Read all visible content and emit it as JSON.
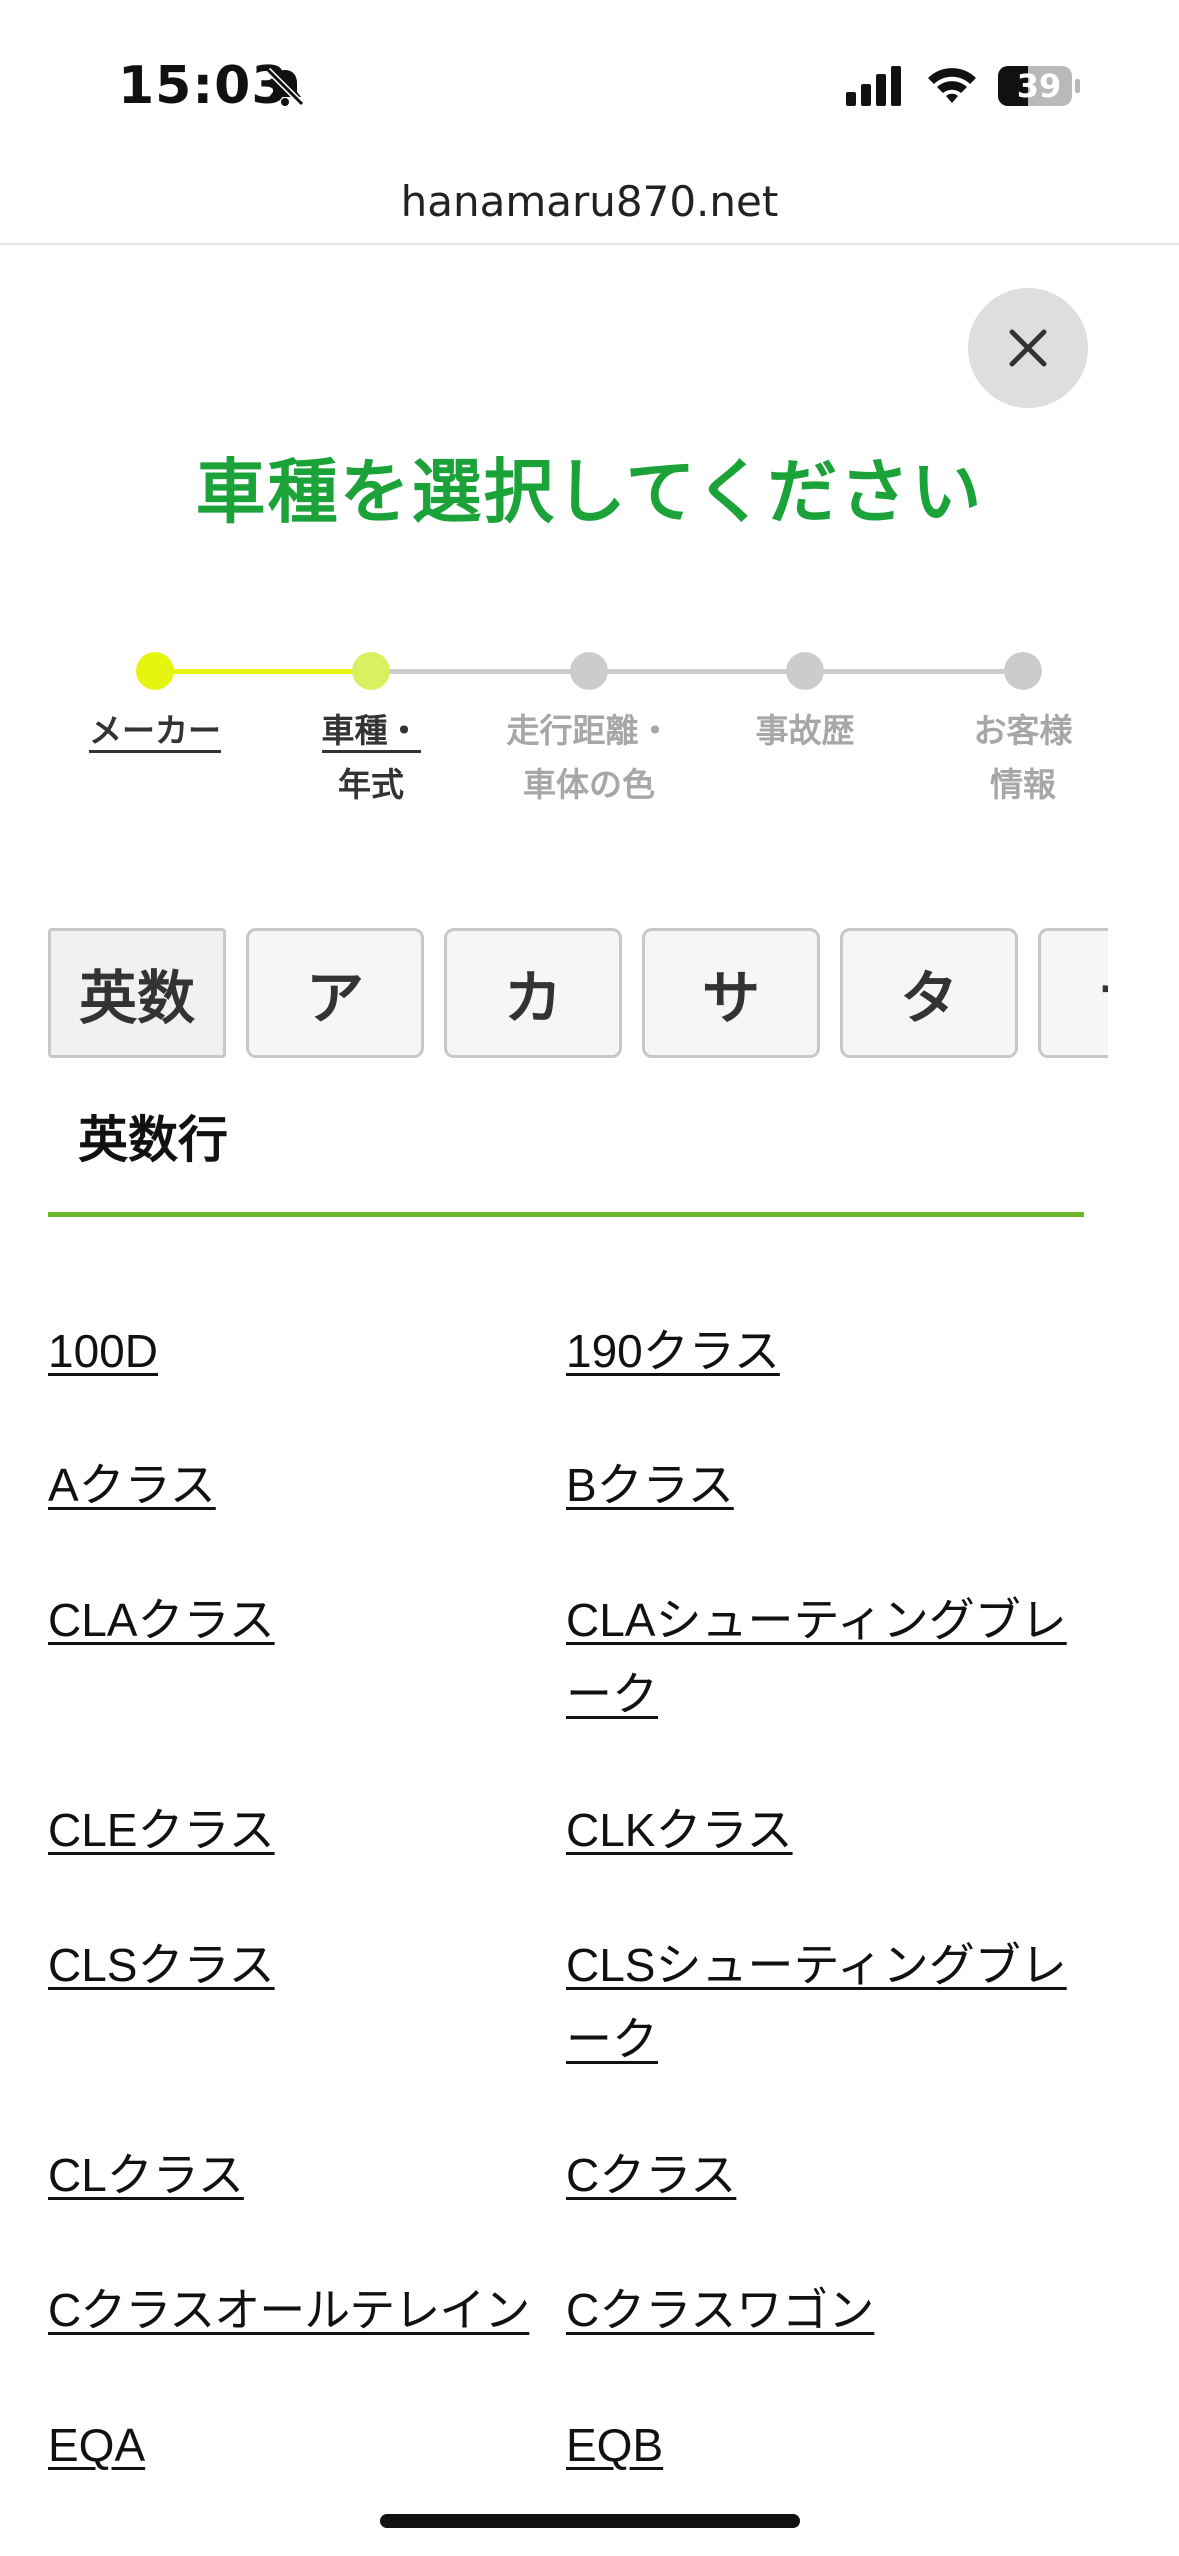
{
  "status": {
    "time": "15:03",
    "battery": "39"
  },
  "url": "hanamaru870.net",
  "title": "車種を選択してください",
  "colors": {
    "accent_green": "#1ba33a",
    "step_active": "#e6f50f",
    "step_done": "#d9f060",
    "step_inactive": "#cccccc",
    "section_line": "#6bb92a"
  },
  "steps": [
    {
      "line1": "メーカー",
      "line2": ""
    },
    {
      "line1": "車種・",
      "line2": "年式"
    },
    {
      "line1": "走行距離・",
      "line2": "車体の色"
    },
    {
      "line1": "事故歴",
      "line2": ""
    },
    {
      "line1": "お客様",
      "line2": "情報"
    }
  ],
  "tabs": [
    "英数",
    "ア",
    "カ",
    "サ",
    "タ",
    "ナ"
  ],
  "section": {
    "title": "英数行"
  },
  "models": [
    "100D",
    "190クラス",
    "Aクラス",
    "Bクラス",
    "CLAクラス",
    "CLAシューティングブレーク",
    "CLEクラス",
    "CLKクラス",
    "CLSクラス",
    "CLSシューティングブレーク",
    "CLクラス",
    "Cクラス",
    "Cクラスオールテレイン",
    "Cクラスワゴン",
    "EQA",
    "EQB"
  ]
}
